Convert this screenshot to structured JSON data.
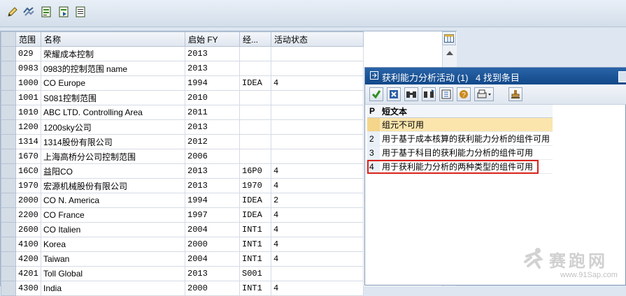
{
  "toolbar": {
    "buttons": [
      {
        "icon": "pencil-icon"
      },
      {
        "icon": "refresh-icon"
      },
      {
        "icon": "document-green-icon"
      },
      {
        "icon": "document-arrow-icon"
      },
      {
        "icon": "document-list-icon"
      }
    ]
  },
  "grid": {
    "headers": [
      "范围",
      "名称",
      "启始 FY",
      "经...",
      "活动状态"
    ],
    "rows": [
      [
        "029",
        "荣耀成本控制",
        "2013",
        "",
        ""
      ],
      [
        "0983",
        "0983的控制范围 name",
        "2013",
        "",
        ""
      ],
      [
        "1000",
        "CO Europe",
        "1994",
        "IDEA",
        "4"
      ],
      [
        "1001",
        "S081控制范围",
        "2010",
        "",
        ""
      ],
      [
        "1010",
        "ABC LTD. Controlling Area",
        "2011",
        "",
        ""
      ],
      [
        "1200",
        "1200sky公司",
        "2013",
        "",
        ""
      ],
      [
        "1314",
        "1314股份有限公司",
        "2012",
        "",
        ""
      ],
      [
        "1670",
        "上海高桥分公司控制范围",
        "2006",
        "",
        ""
      ],
      [
        "16C0",
        "益阳CO",
        "2013",
        "16P0",
        "4"
      ],
      [
        "1970",
        "宏源机械股份有限公司",
        "2013",
        "1970",
        "4"
      ],
      [
        "2000",
        "CO N. America",
        "1994",
        "IDEA",
        "2"
      ],
      [
        "2200",
        "CO France",
        "1997",
        "IDEA",
        "4"
      ],
      [
        "2600",
        "CO Italien",
        "2004",
        "INT1",
        "4"
      ],
      [
        "4100",
        "Korea",
        "2000",
        "INT1",
        "4"
      ],
      [
        "4200",
        "Taiwan",
        "2004",
        "INT1",
        "4"
      ],
      [
        "4201",
        "Toll Global",
        "2013",
        "S001",
        ""
      ],
      [
        "4300",
        "India",
        "2000",
        "INT1",
        "4"
      ]
    ]
  },
  "popup": {
    "title": "获利能力分析活动 (1)",
    "count": "4 找到条目",
    "headers": [
      "P",
      "短文本"
    ],
    "rows": [
      {
        "key": "",
        "text": "组元不可用"
      },
      {
        "key": "2",
        "text": "用于基于成本核算的获利能力分析的组件可用"
      },
      {
        "key": "3",
        "text": "用于基于科目的获利能力分析的组件可用"
      },
      {
        "key": "4",
        "text": "用于获利能力分析的两种类型的组件可用"
      }
    ],
    "highlight_color": "#fbe5ad",
    "annotation_color": "#d8231c"
  },
  "watermark": {
    "text": "赛跑网",
    "url": "www.91Sap.com"
  }
}
